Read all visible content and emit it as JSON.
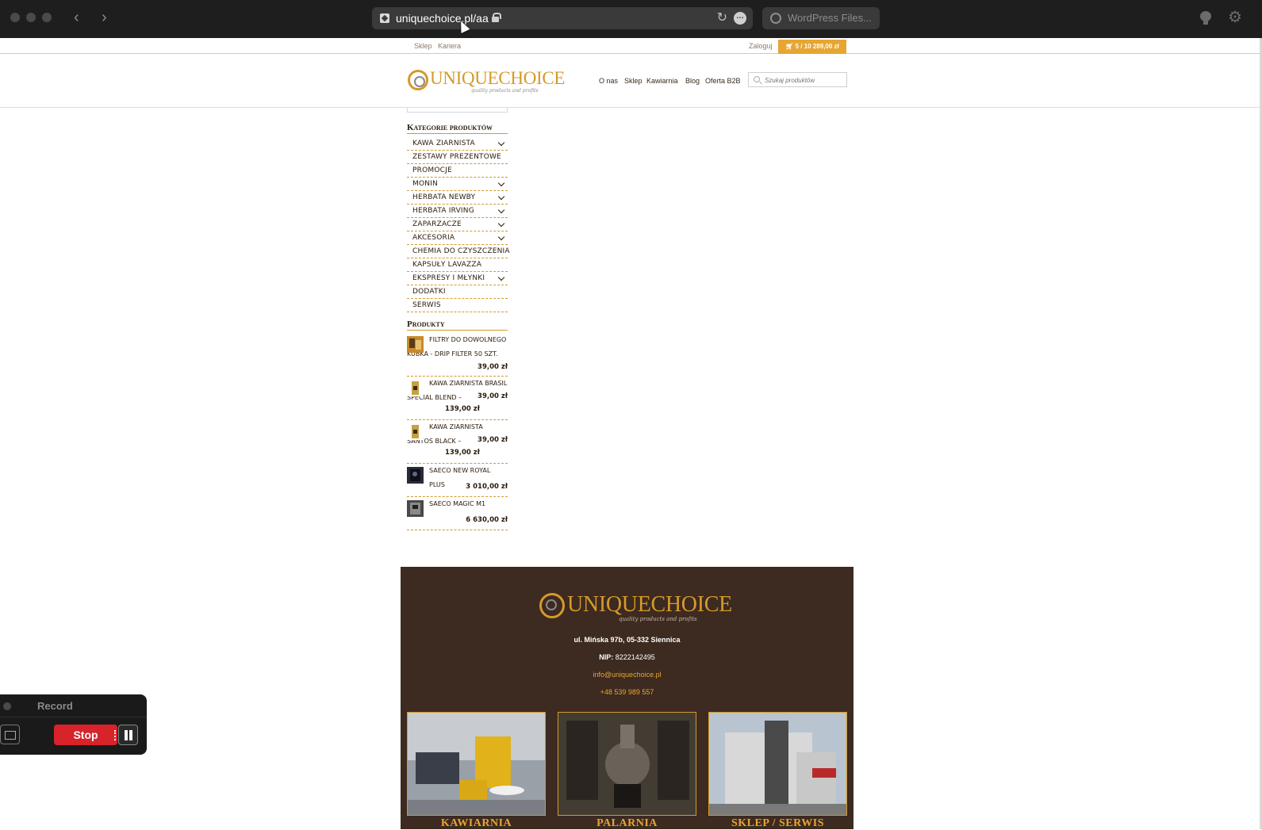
{
  "browser": {
    "url": "uniquechoice.pl/aa",
    "second_tab": "WordPress Files..."
  },
  "topbar": {
    "links": [
      "Sklep",
      "Kariera"
    ],
    "login": "Zaloguj",
    "cart": "5 / 10 289,00 zł"
  },
  "header": {
    "logo_text": "UNIQUECHOICE",
    "logo_tag": "quality products and profits",
    "nav": [
      "O nas",
      "Sklep",
      "Kawiarnia",
      "Blog",
      "Oferta B2B"
    ],
    "search_placeholder": "Szukaj produktów"
  },
  "categories": {
    "title": "Kategorie produktów",
    "items": [
      {
        "label": "KAWA ZIARNISTA",
        "expandable": true
      },
      {
        "label": "ZESTAWY PREZENTOWE",
        "expandable": false
      },
      {
        "label": "PROMOCJE",
        "expandable": false
      },
      {
        "label": "MONIN",
        "expandable": true
      },
      {
        "label": "HERBATA NEWBY",
        "expandable": true
      },
      {
        "label": "HERBATA IRVING",
        "expandable": true
      },
      {
        "label": "ZAPARZACZE",
        "expandable": true
      },
      {
        "label": "AKCESORIA",
        "expandable": true
      },
      {
        "label": "CHEMIA DO CZYSZCZENIA",
        "expandable": false
      },
      {
        "label": "KAPSUŁY LAVAZZA",
        "expandable": false
      },
      {
        "label": "EKSPRESY I MŁYNKI",
        "expandable": true
      },
      {
        "label": "DODATKI",
        "expandable": false
      },
      {
        "label": "SERWIS",
        "expandable": false
      }
    ]
  },
  "products": {
    "title": "Produkty",
    "items": [
      {
        "name_1": "FILTRY DO DOWOLNEGO",
        "name_2": "KUBKA - DRIP FILTER 50 SZT.",
        "price": "39,00 zł",
        "old": ""
      },
      {
        "name_1": "KAWA ZIARNISTA BRASIL",
        "name_2": "SPECIAL BLEND –",
        "price": "39,00 zł",
        "old": "139,00 zł"
      },
      {
        "name_1": "KAWA ZIARNISTA",
        "name_2": "SANTOS BLACK –",
        "price": "39,00 zł",
        "old": "139,00 zł"
      },
      {
        "name_1": "SAECO NEW ROYAL PLUS",
        "name_2": "",
        "price": "3 010,00 zł",
        "old": ""
      },
      {
        "name_1": "SAECO MAGIC M1",
        "name_2": "",
        "price": "6 630,00 zł",
        "old": ""
      }
    ]
  },
  "footer": {
    "address": "ul. Mińska 97b, 05-332 Siennica",
    "nip_label": "NIP:",
    "nip": "8222142495",
    "email": "info@uniquechoice.pl",
    "phone": "+48 539 989 557",
    "tiles": [
      "KAWIARNIA",
      "PALARNIA",
      "SKLEP / SERWIS"
    ]
  },
  "recorder": {
    "title": "Record",
    "stop": "Stop"
  },
  "colors": {
    "accent": "#e6a631",
    "footer_bg": "#3d2a20",
    "chrome_bg": "#1e1e1e",
    "stop_red": "#d8232a"
  }
}
